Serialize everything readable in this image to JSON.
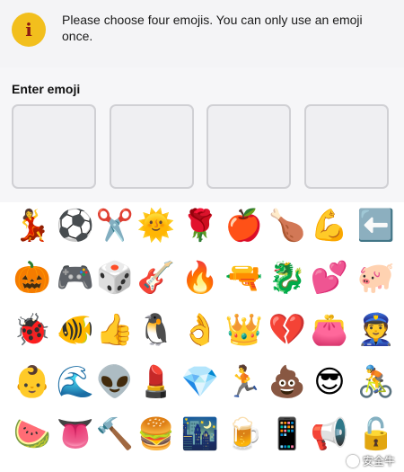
{
  "info_banner": {
    "icon": "info-icon",
    "icon_glyph": "i",
    "message": "Please choose four emojis. You can only use an emoji once."
  },
  "entry": {
    "label": "Enter emoji",
    "slots": [
      "",
      "",
      "",
      ""
    ]
  },
  "emoji_grid": {
    "rows": [
      [
        "💃",
        "⚽",
        "✂️",
        "🌞",
        "🌹",
        "🍎",
        "🍗",
        "💪",
        "⬅️"
      ],
      [
        "🎃",
        "🎮",
        "🎲",
        "🎸",
        "🔥",
        "🔫",
        "🐉",
        "💕",
        "🐖"
      ],
      [
        "🐞",
        "🐠",
        "👍",
        "🐧",
        "👌",
        "👑",
        "💔",
        "👛",
        "👮"
      ],
      [
        "👶",
        "🌊",
        "👽",
        "💄",
        "💎",
        "🏃",
        "💩",
        "😎",
        "🚴"
      ],
      [
        "🍉",
        "👅",
        "🔨",
        "🍔",
        "🌃",
        "🍺",
        "📱",
        "📢",
        "🔓"
      ]
    ]
  },
  "watermark": {
    "text": "安全牛"
  }
}
